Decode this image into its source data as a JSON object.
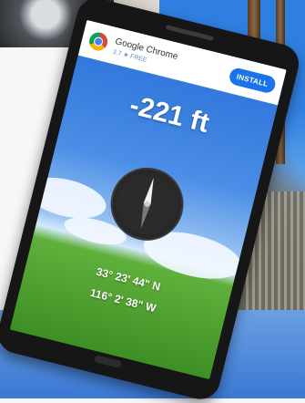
{
  "ad": {
    "app_name": "Google Chrome",
    "rating_price": "3.7 ★ FREE",
    "install_label": "INSTALL",
    "icon": "chrome-logo-icon"
  },
  "altimeter": {
    "altitude": "-221 ft",
    "latitude": "33° 23' 44\" N",
    "longitude": "116° 2' 38\" W"
  },
  "compass": {
    "icon": "compass-icon"
  },
  "colors": {
    "install_button": "#1a73e8",
    "sky": "#4a8ee6",
    "grass": "#4fa02e"
  }
}
